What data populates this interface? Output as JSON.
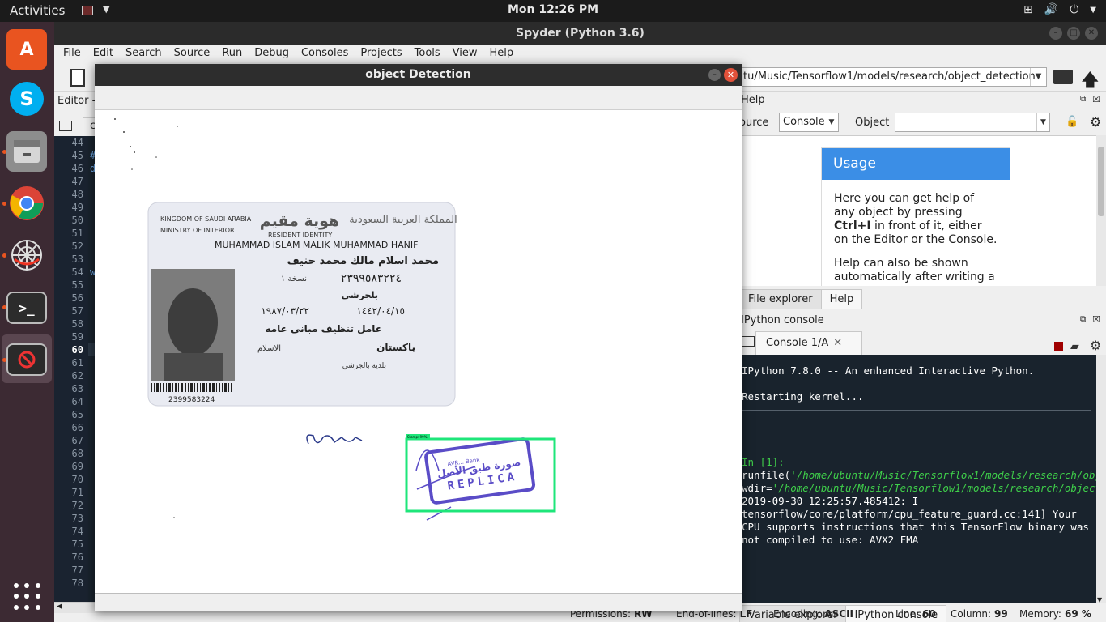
{
  "topbar": {
    "activities": "Activities",
    "clock": "Mon 12:26 PM"
  },
  "dock": {
    "items": [
      "software-center",
      "skype",
      "files",
      "chrome",
      "spider-app",
      "terminal",
      "spyder-app"
    ]
  },
  "spyder": {
    "title": "Spyder (Python 3.6)",
    "menu": [
      "File",
      "Edit",
      "Search",
      "Source",
      "Run",
      "Debug",
      "Consoles",
      "Projects",
      "Tools",
      "View",
      "Help"
    ],
    "working_dir": "tu/Music/Tensorflow1/models/research/object_detection",
    "editor": {
      "label": "Editor -",
      "tab_fragment": "c",
      "current_line": "60",
      "line_numbers": [
        "44",
        "45",
        "46",
        "47",
        "48",
        "49",
        "50",
        "51",
        "52",
        "53",
        "54",
        "55",
        "56",
        "57",
        "58",
        "59",
        "60",
        "61",
        "62",
        "63",
        "64",
        "65",
        "66",
        "67",
        "68",
        "69",
        "70",
        "71",
        "72",
        "73",
        "74",
        "75",
        "76",
        "77",
        "78"
      ],
      "code_fragments": {
        "45": "#",
        "46": "de",
        "54": "wi"
      }
    },
    "help": {
      "title": "Help",
      "source_label": "ource",
      "source_value": "Console",
      "object_label": "Object",
      "usage_title": "Usage",
      "usage_p1_a": "Here you can get help of any object by pressing ",
      "usage_p1_bold": "Ctrl+I",
      "usage_p1_b": " in front of it, either on the Editor or the Console.",
      "usage_p2": "Help can also be shown automatically after writing a",
      "tabs": [
        "File explorer",
        "Help"
      ]
    },
    "console": {
      "title": "IPython console",
      "tab": "Console 1/A",
      "banner": "IPython 7.8.0 -- An enhanced Interactive Python.",
      "restart": "Restarting kernel...",
      "prompt": "In [1]: ",
      "cmd": "runfile(",
      "arg1": "'/home/ubuntu/Music/Tensorflow1/models/research/object_detection/object_detection_image.py'",
      "comma": ",",
      "wdir_key": "wdir=",
      "arg2": "'/home/ubuntu/Music/Tensorflow1/models/research/object_detection'",
      "close": ")",
      "log": "2019-09-30 12:25:57.485412: I tensorflow/core/platform/cpu_feature_guard.cc:141] Your CPU supports instructions that this TensorFlow binary was not compiled to use: AVX2 FMA",
      "tabs": [
        "Variable explorer",
        "IPython console"
      ]
    },
    "status": {
      "permissions_label": "Permissions:",
      "permissions": "RW",
      "eol_label": "End-of-lines:",
      "eol": "LF",
      "encoding_label": "Encoding:",
      "encoding": "ASCII",
      "line_label": "Line:",
      "line": "60",
      "column_label": "Column:",
      "column": "99",
      "memory_label": "Memory:",
      "memory": "69 %"
    }
  },
  "detection_window": {
    "title": "object Detection",
    "card": {
      "country": "KINGDOM OF SAUDI ARABIA",
      "ministry": "MINISTRY OF INTERIOR",
      "arabic_title": "هوية مقيم",
      "arabic_kingdom": "المملكة العربية السعودية",
      "resident_identity": "RESIDENT IDENTITY",
      "name": "MUHAMMAD ISLAM MALIK MUHAMMAD HANIF",
      "name_ar": "محمد اسلام مالك محمد حنيف",
      "id_ar": "٢٣٩٩٥٨٣٢٢٤",
      "copy_ar": "نسخة ١",
      "issue_place_ar": "بلجرشي",
      "expiry_ar": "١٤٤٢/٠٤/١٥",
      "birth_ar": "١٩٨٧/٠٣/٢٢",
      "occupation_ar": "عامل تنظيف مباني عامه",
      "nationality_ar": "باكستان",
      "religion_ar": "الاسلام",
      "employer_ar": "بلدية بالجرشي",
      "barcode_number": "2399583224"
    },
    "stamp": {
      "text_top": "AVR... Bank",
      "text_ar": "صورة طبق الأصل",
      "text_main": "REPLICA",
      "label": "Stamp: 99%"
    },
    "signature": "محمد اسلام"
  },
  "colors": {
    "detection_box": "#1ee67a",
    "usage_header": "#3b8ee6",
    "console_bg": "#19232d",
    "dock_bg": "#3c2a33"
  }
}
